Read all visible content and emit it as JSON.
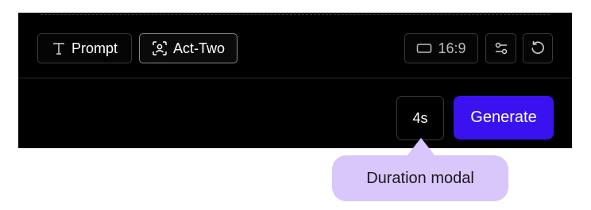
{
  "toolbar": {
    "prompt_label": "Prompt",
    "act_two_label": "Act-Two",
    "aspect_ratio": "16:9"
  },
  "footer": {
    "duration_value": "4s",
    "generate_label": "Generate"
  },
  "tooltip": {
    "text": "Duration modal"
  },
  "colors": {
    "panel_bg": "#000000",
    "generate_bg": "#3a12f0",
    "tooltip_bg": "#d9c6fb"
  },
  "icons": {
    "prompt": "text-icon",
    "act_two": "face-scan-icon",
    "ratio": "rectangle-icon",
    "settings": "sliders-icon",
    "reset": "refresh-icon"
  }
}
